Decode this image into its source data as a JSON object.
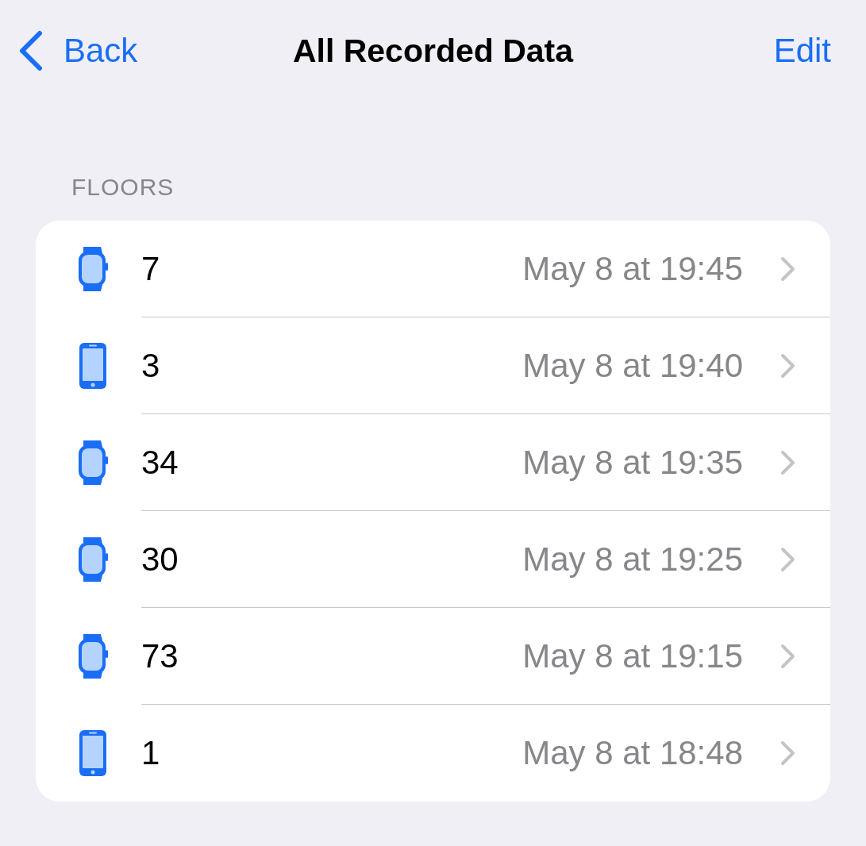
{
  "nav": {
    "back": "Back",
    "title": "All Recorded Data",
    "action": "Edit"
  },
  "section": {
    "header": "FLOORS",
    "rows": [
      {
        "kind": "watch",
        "value": "7",
        "date": "May 8 at 19:45"
      },
      {
        "kind": "phone",
        "value": "3",
        "date": "May 8 at 19:40"
      },
      {
        "kind": "watch",
        "value": "34",
        "date": "May 8 at 19:35"
      },
      {
        "kind": "watch",
        "value": "30",
        "date": "May 8 at 19:25"
      },
      {
        "kind": "watch",
        "value": "73",
        "date": "May 8 at 19:15"
      },
      {
        "kind": "phone",
        "value": "1",
        "date": "May 8 at 18:48"
      }
    ]
  }
}
